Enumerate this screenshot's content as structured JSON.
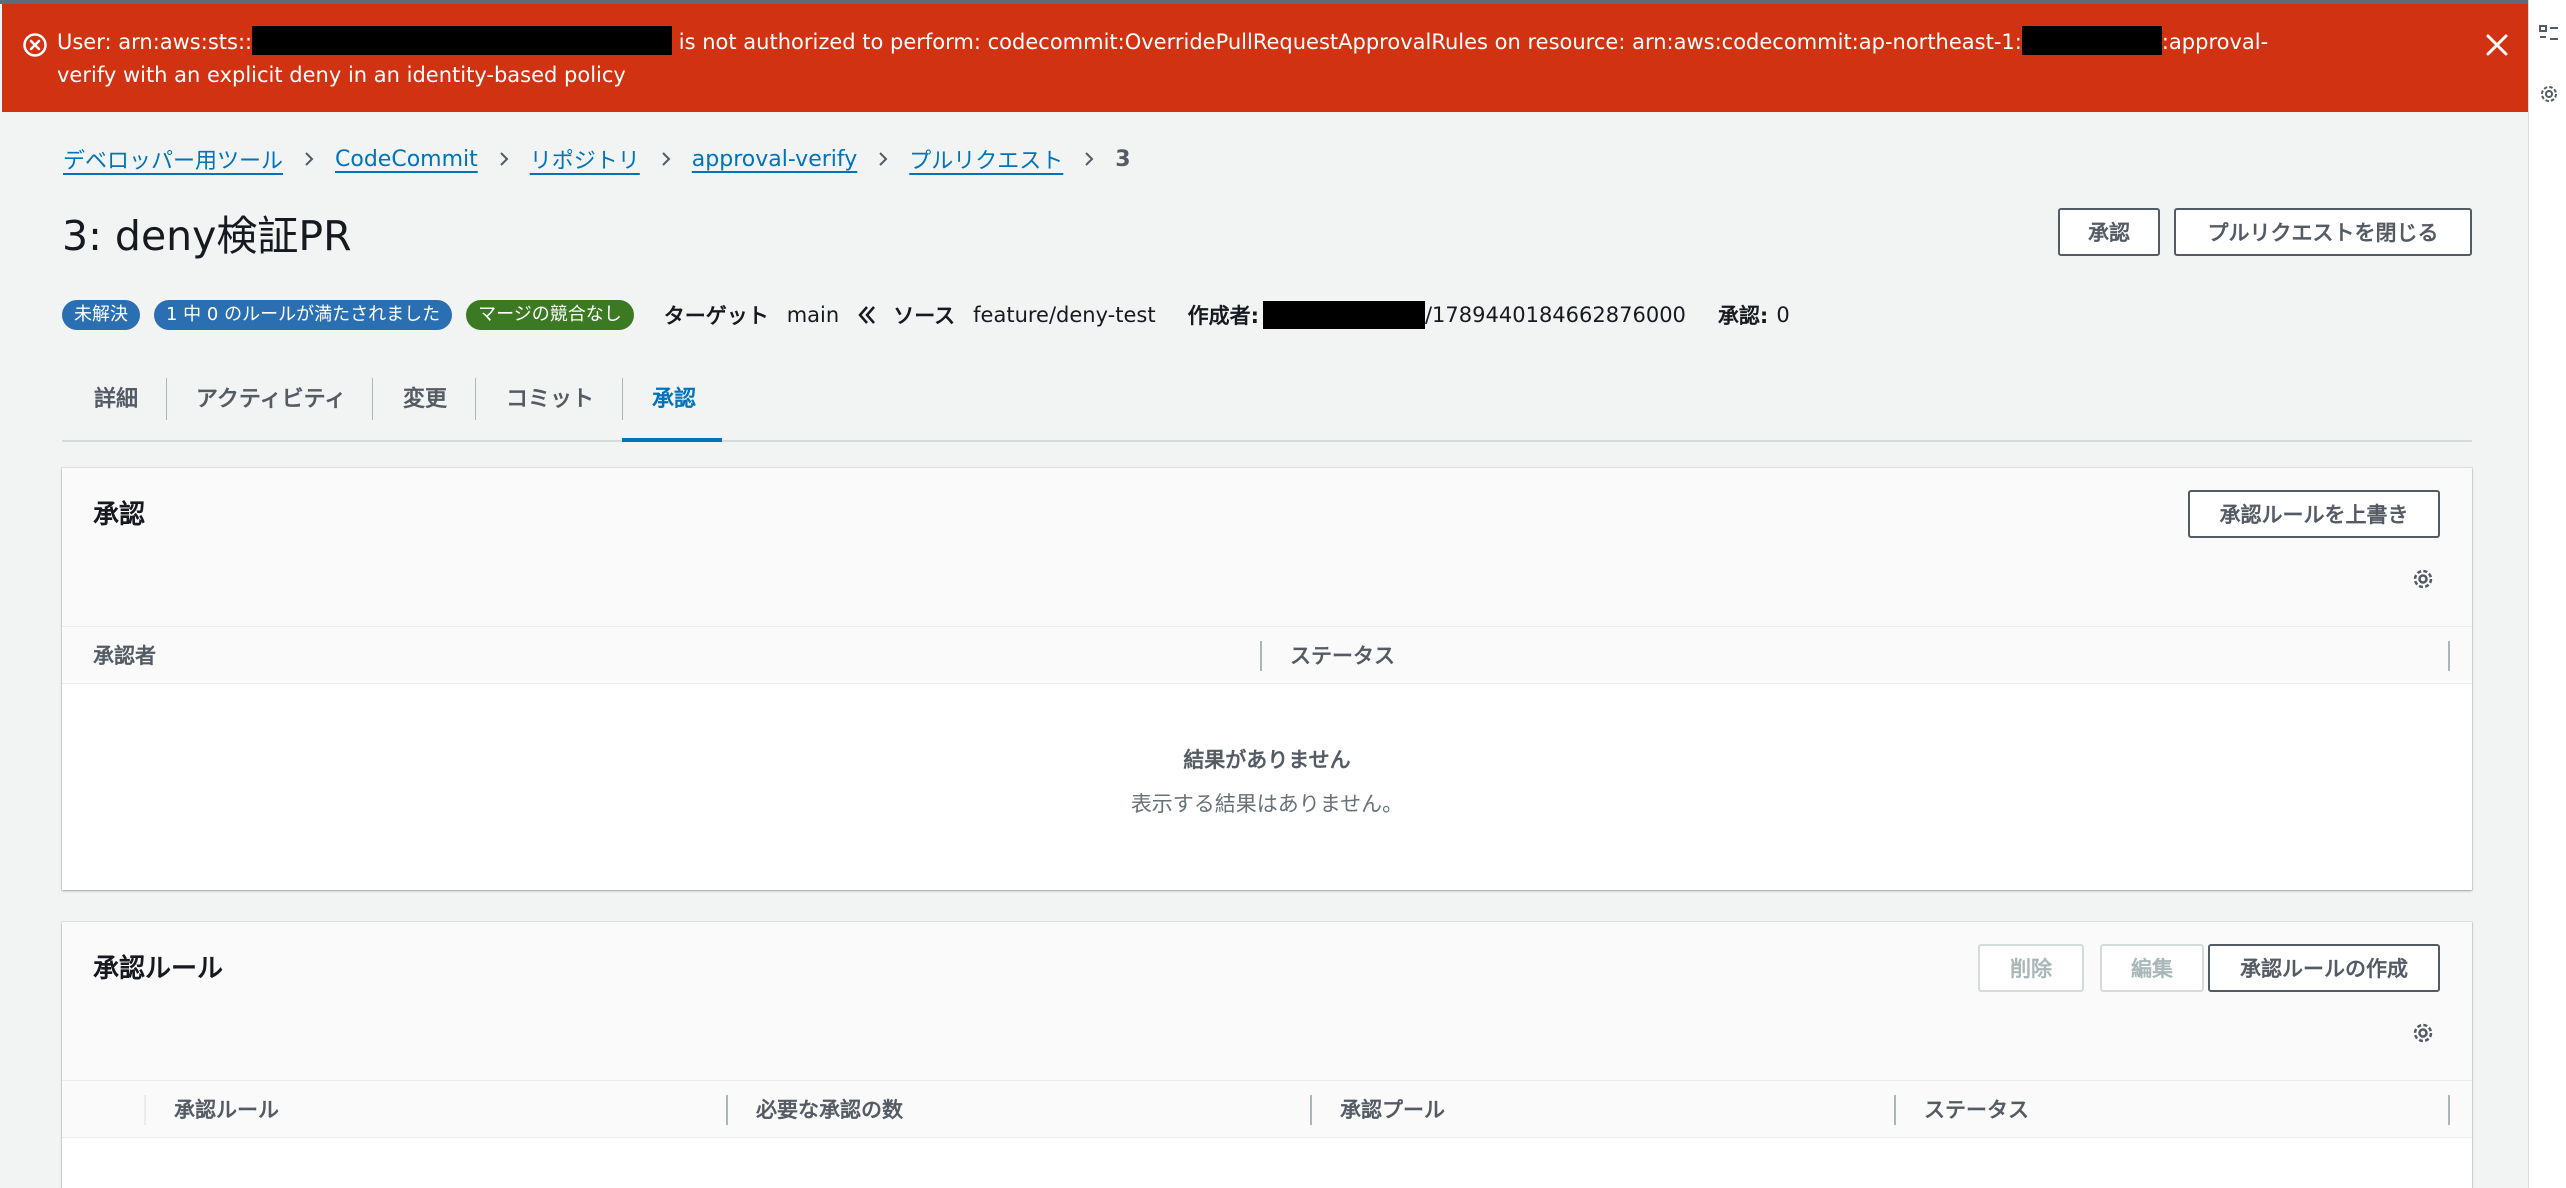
{
  "error": {
    "part1": "User: arn:aws:sts::",
    "part2": " is not authorized to perform: codecommit:OverridePullRequestApprovalRules on resource: arn:aws:codecommit:ap-northeast-1:",
    "part3": ":approval-",
    "line2": "verify with an explicit deny in an identity-based policy"
  },
  "breadcrumbs": {
    "items": [
      "デベロッパー用ツール",
      "CodeCommit",
      "リポジトリ",
      "approval-verify",
      "プルリクエスト"
    ],
    "current": "3"
  },
  "title": "3: deny検証PR",
  "header_buttons": {
    "approve": "承認",
    "close_pr": "プルリクエストを閉じる"
  },
  "meta": {
    "badges": [
      "未解決",
      "1 中 0 のルールが満たされました",
      "マージの競合なし"
    ],
    "target_label": "ターゲット",
    "target_value": "main",
    "source_label": "ソース",
    "source_value": "feature/deny-test",
    "author_label": "作成者:",
    "author_suffix": "/1789440184662876000",
    "approvals_label": "承認:",
    "approvals_value": "0"
  },
  "tabs": [
    "詳細",
    "アクティビティ",
    "変更",
    "コミット",
    "承認"
  ],
  "active_tab": "承認",
  "approvals_panel": {
    "title": "承認",
    "override_button": "承認ルールを上書き",
    "columns": [
      "承認者",
      "ステータス"
    ],
    "empty_title": "結果がありません",
    "empty_message": "表示する結果はありません。"
  },
  "rules_panel": {
    "title": "承認ルール",
    "delete_button": "削除",
    "edit_button": "編集",
    "create_button": "承認ルールの作成",
    "columns": [
      "承認ルール",
      "必要な承認の数",
      "承認プール",
      "ステータス"
    ]
  },
  "colors": {
    "error_banner": "#d13212",
    "link": "#0073bb",
    "badge_blue": "#2b6fb3",
    "badge_green": "#3b7a22"
  }
}
